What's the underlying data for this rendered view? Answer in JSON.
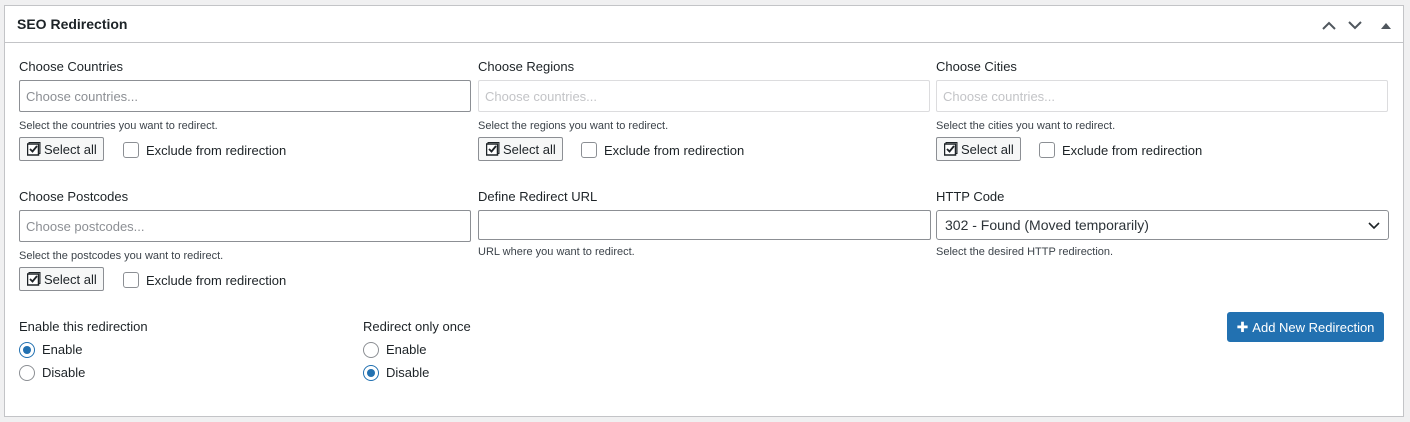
{
  "panel": {
    "title": "SEO Redirection"
  },
  "countries": {
    "label": "Choose Countries",
    "placeholder": "Choose countries...",
    "description": "Select the countries you want to redirect.",
    "select_all": "Select all",
    "exclude": "Exclude from redirection"
  },
  "regions": {
    "label": "Choose Regions",
    "placeholder": "Choose countries...",
    "description": "Select the regions you want to redirect.",
    "select_all": "Select all",
    "exclude": "Exclude from redirection"
  },
  "cities": {
    "label": "Choose Cities",
    "placeholder": "Choose countries...",
    "description": "Select the cities you want to redirect.",
    "select_all": "Select all",
    "exclude": "Exclude from redirection"
  },
  "postcodes": {
    "label": "Choose Postcodes",
    "placeholder": "Choose postcodes...",
    "description": "Select the postcodes you want to redirect.",
    "select_all": "Select all",
    "exclude": "Exclude from redirection"
  },
  "redirect_url": {
    "label": "Define Redirect URL",
    "value": "",
    "description": "URL where you want to redirect."
  },
  "http_code": {
    "label": "HTTP Code",
    "selected": "302 - Found (Moved temporarily)",
    "description": "Select the desired HTTP redirection."
  },
  "enable_redirection": {
    "label": "Enable this redirection",
    "options": [
      "Enable",
      "Disable"
    ],
    "selected": "Enable"
  },
  "redirect_once": {
    "label": "Redirect only once",
    "options": [
      "Enable",
      "Disable"
    ],
    "selected": "Disable"
  },
  "add_button": {
    "label": "Add New Redirection",
    "icon": "plus-icon"
  },
  "colors": {
    "accent": "#2271b1",
    "border": "#8c8f94",
    "background": "#f0f0f1"
  }
}
